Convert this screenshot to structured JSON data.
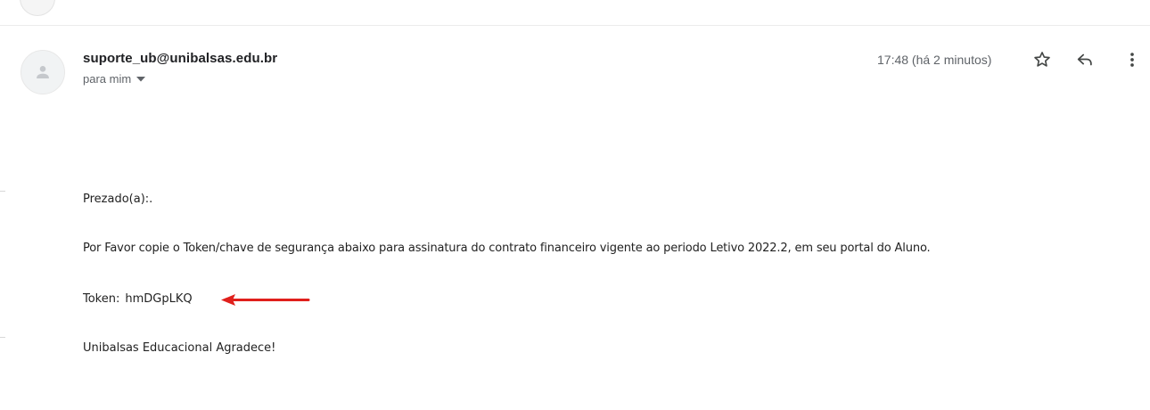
{
  "email": {
    "sender": "suporte_ub@unibalsas.edu.br",
    "recipient_label": "para mim",
    "timestamp": "17:48 (há 2 minutos)",
    "icons": {
      "avatar": "person-icon",
      "star": "star-icon",
      "reply": "reply-icon",
      "more": "more-vert-icon",
      "recipient_dropdown": "caret-down-icon"
    },
    "body": {
      "greeting": "Prezado(a):.",
      "instruction": "Por Favor copie o Token/chave de segurança abaixo para assinatura do contrato financeiro vigente ao periodo Letivo 2022.2, em seu portal do Aluno.",
      "token_label": "Token:",
      "token_value": "hmDGpLKQ",
      "closing": "Unibalsas Educacional Agradece!"
    },
    "annotation": {
      "arrow_color": "#e0201c",
      "arrow_icon": "arrow-left-icon"
    }
  }
}
